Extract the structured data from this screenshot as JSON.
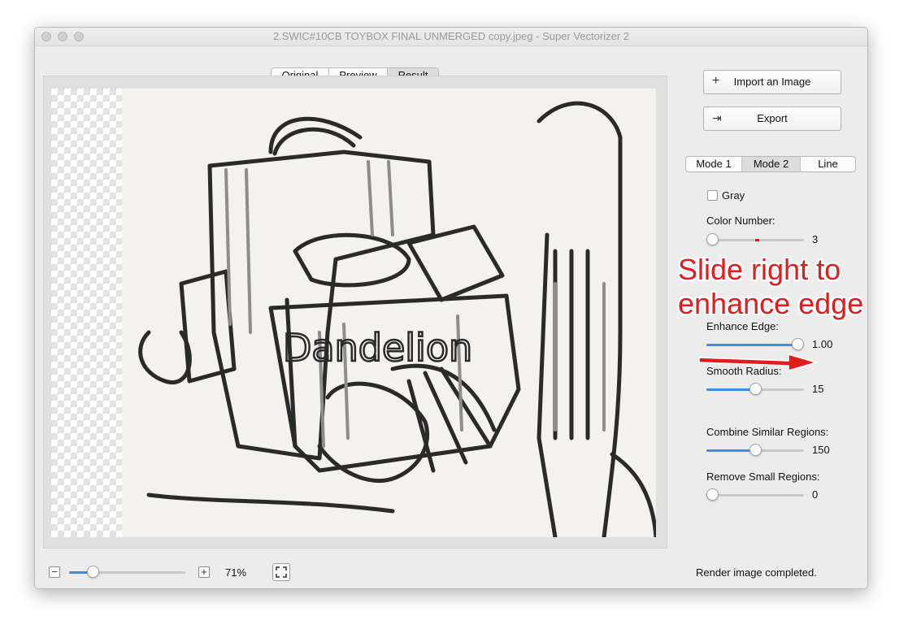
{
  "window": {
    "title": "2.SWIC#10CB TOYBOX FINAL UNMERGED copy.jpeg - Super Vectorizer 2"
  },
  "view_tabs": [
    {
      "label": "Original",
      "selected": false
    },
    {
      "label": "Preview",
      "selected": false
    },
    {
      "label": "Result",
      "selected": true
    }
  ],
  "canvas": {
    "text": "Dandelion"
  },
  "actions": {
    "import_label": "Import an Image",
    "import_icon": "plus-icon",
    "export_label": "Export",
    "export_icon": "export-icon"
  },
  "mode_tabs": [
    {
      "label": "Mode 1",
      "selected": false
    },
    {
      "label": "Mode 2",
      "selected": true
    },
    {
      "label": "Line",
      "selected": false
    }
  ],
  "settings": {
    "gray": {
      "label": "Gray",
      "checked": false
    },
    "color_number": {
      "label": "Color Number:",
      "value": "3",
      "fraction": 0.0
    },
    "enhance_edge": {
      "label": "Enhance Edge:",
      "value": "1.00",
      "fraction": 1.0
    },
    "smooth_radius": {
      "label": "Smooth Radius:",
      "value": "15",
      "fraction": 0.5
    },
    "combine_similar": {
      "label": "Combine Similar Regions:",
      "value": "150",
      "fraction": 0.5
    },
    "remove_small": {
      "label": "Remove Small Regions:",
      "value": "0",
      "fraction": 0.0
    }
  },
  "zoom": {
    "percent": "71%",
    "fraction": 0.17
  },
  "status": "Render image completed.",
  "annotation": {
    "line1": "Slide right to",
    "line2": "enhance edge",
    "color": "#e11c1c"
  },
  "colors": {
    "accent": "#3a8ee6",
    "annotation": "#e11c1c"
  }
}
